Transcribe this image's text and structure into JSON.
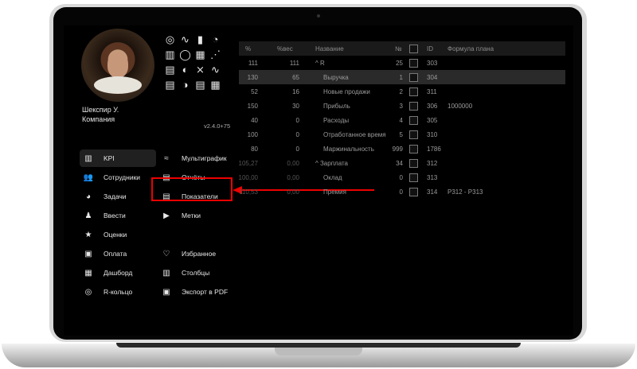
{
  "profile": {
    "name": "Шекспир У.\nКомпания",
    "version": "v2.4.0+75"
  },
  "icon_grid": [
    "◎",
    "∿",
    "▮",
    "◔",
    "▥",
    "◯",
    "▦",
    "⋰",
    "▤",
    "◐",
    "⨯",
    "∿",
    "▤",
    "◑",
    "▤",
    "▦"
  ],
  "menu_left": [
    {
      "label": "KPI",
      "icon": "chart-icon",
      "glyph": "▥"
    },
    {
      "label": "Сотрудники",
      "icon": "people-icon",
      "glyph": "👥"
    },
    {
      "label": "Задачи",
      "icon": "tasks-icon",
      "glyph": "◕"
    },
    {
      "label": "Ввести",
      "icon": "bell-icon",
      "glyph": "♟"
    },
    {
      "label": "Оценки",
      "icon": "star-icon",
      "glyph": "★"
    },
    {
      "label": "Оплата",
      "icon": "payment-icon",
      "glyph": "▣"
    },
    {
      "label": "Дашборд",
      "icon": "dashboard-icon",
      "glyph": "▦"
    },
    {
      "label": "R-кольцо",
      "icon": "ring-icon",
      "glyph": "◎"
    }
  ],
  "menu_right": [
    {
      "label": "Мультиграфик",
      "icon": "multichart-icon",
      "glyph": "≈"
    },
    {
      "label": "Отчёты",
      "icon": "reports-icon",
      "glyph": "▤"
    },
    {
      "label": "Показатели",
      "icon": "indicators-icon",
      "glyph": "▤"
    },
    {
      "label": "Метки",
      "icon": "tag-icon",
      "glyph": "▶"
    },
    {
      "label": "Избранное",
      "icon": "heart-icon",
      "glyph": "♡"
    },
    {
      "label": "Столбцы",
      "icon": "columns-icon",
      "glyph": "▥"
    },
    {
      "label": "Экспорт в PDF",
      "icon": "pdf-icon",
      "glyph": "▣"
    }
  ],
  "table": {
    "headers": [
      "%",
      "%вес",
      "Название",
      "№",
      "",
      "ID",
      "Формула плана"
    ],
    "rows": [
      [
        "111",
        "111",
        "^ R",
        "25",
        "",
        "303",
        ""
      ],
      [
        "130",
        "65",
        "Выручка",
        "1",
        "",
        "304",
        ""
      ],
      [
        "52",
        "16",
        "Новые продажи",
        "2",
        "",
        "311",
        ""
      ],
      [
        "150",
        "30",
        "Прибыль",
        "3",
        "",
        "306",
        "1000000"
      ],
      [
        "40",
        "0",
        "Расходы",
        "4",
        "",
        "305",
        ""
      ],
      [
        "100",
        "0",
        "Отработанное время",
        "5",
        "",
        "310",
        ""
      ],
      [
        "80",
        "0",
        "Маржинальность",
        "999",
        "",
        "1786",
        ""
      ],
      [
        "105,27",
        "0,00",
        "^ Зарплата",
        "34",
        "",
        "312",
        ""
      ],
      [
        "100,00",
        "0,00",
        "Оклад",
        "0",
        "",
        "313",
        ""
      ],
      [
        "110,53",
        "0,00",
        "Премия",
        "0",
        "",
        "314",
        "P312 - P313"
      ]
    ]
  },
  "colors": {
    "highlight": "#e00000",
    "screen": "#000000"
  }
}
